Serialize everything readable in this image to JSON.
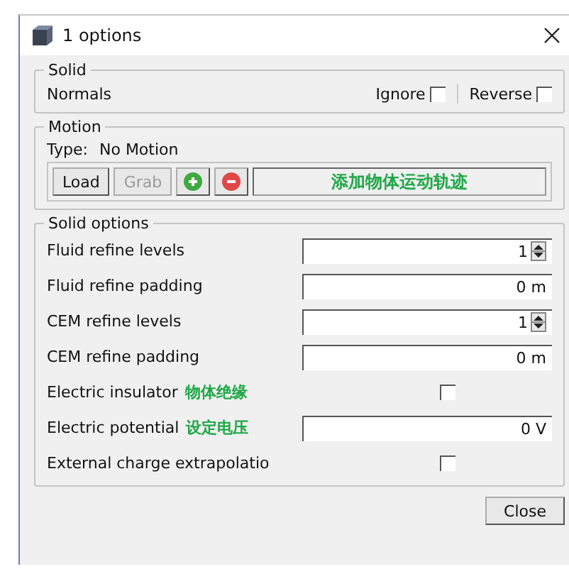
{
  "window": {
    "title": "1 options"
  },
  "solid": {
    "title": "Solid",
    "label": "Normals",
    "options": [
      {
        "label": "Ignore",
        "checked": false
      },
      {
        "label": "Reverse",
        "checked": false
      }
    ]
  },
  "motion": {
    "title": "Motion",
    "type_label": "Type:",
    "type_value": "No Motion",
    "buttons": [
      {
        "label": "Load",
        "disabled": false
      },
      {
        "label": "Grab",
        "disabled": true
      }
    ],
    "annotation": "添加物体运动轨迹"
  },
  "solid_options": {
    "title": "Solid options",
    "rows": [
      {
        "kind": "spin",
        "label": "Fluid refine levels",
        "value": "1"
      },
      {
        "kind": "text",
        "label": "Fluid refine padding",
        "value": "0 m"
      },
      {
        "kind": "spin",
        "label": "CEM refine levels",
        "value": "1"
      },
      {
        "kind": "text",
        "label": "CEM refine padding",
        "value": "0 m"
      },
      {
        "kind": "check",
        "label": "Electric insulator",
        "note": "物体绝缘",
        "checked": false
      },
      {
        "kind": "text",
        "label": "Electric potential",
        "note": "设定电压",
        "value": "0 V"
      },
      {
        "kind": "check",
        "label": "External charge extrapolatio",
        "checked": false
      }
    ]
  },
  "footer": {
    "button": "Close"
  }
}
